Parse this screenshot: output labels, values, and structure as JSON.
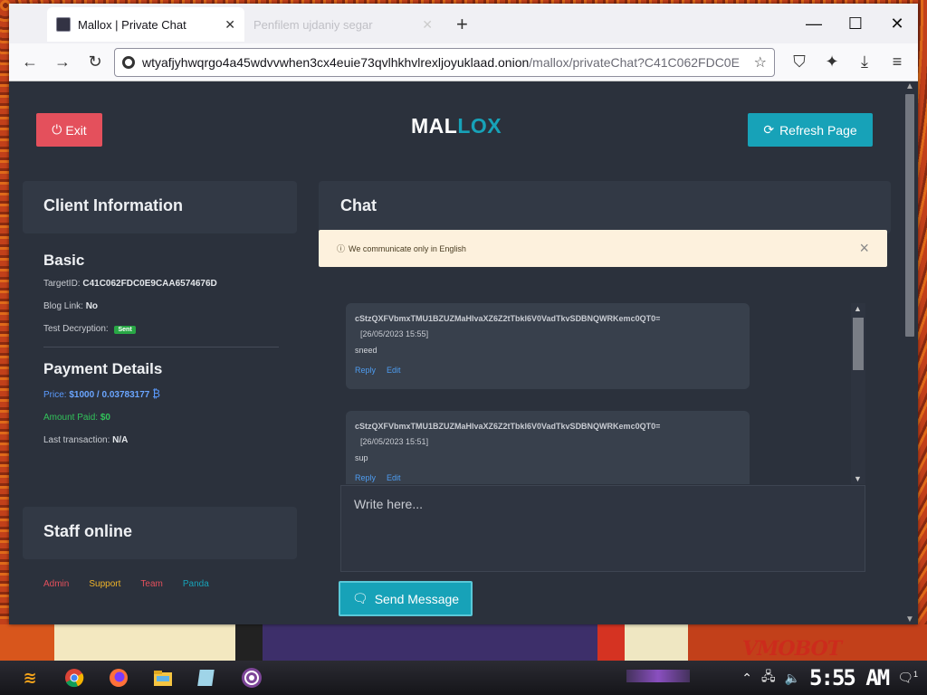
{
  "browser": {
    "tabs": [
      {
        "title": "Mallox | Private Chat",
        "active": true
      },
      {
        "title": "Penfilem ujdaniy segar",
        "active": false
      }
    ],
    "url_host": "wtyafjyhwqrgo4a45wdvvwhen3cx4euie73qvlhkhvlrexljoyuklaad.onion",
    "url_path": "/mallox/privateChat?C41C062FDC0E"
  },
  "header": {
    "exit_label": "Exit",
    "logo_part1": "MAL",
    "logo_part2": "LOX",
    "refresh_label": "Refresh Page"
  },
  "client_info": {
    "title": "Client Information",
    "basic_title": "Basic",
    "target_label": "TargetID:",
    "target_value": "C41C062FDC0E9CAA6574676D",
    "blog_label": "Blog Link:",
    "blog_value": "No",
    "test_label": "Test Decryption:",
    "test_badge": "Sent",
    "payment_title": "Payment Details",
    "price_label": "Price:",
    "price_value": "$1000 / 0.03783177",
    "paid_label": "Amount Paid:",
    "paid_value": "$0",
    "last_label": "Last transaction:",
    "last_value": "N/A"
  },
  "staff": {
    "title": "Staff online",
    "members": [
      {
        "name": "Admin",
        "color": "#e4505c"
      },
      {
        "name": "Support",
        "color": "#f0b429"
      },
      {
        "name": "Team",
        "color": "#e4505c"
      },
      {
        "name": "Panda",
        "color": "#17a2b8"
      }
    ]
  },
  "chat": {
    "title": "Chat",
    "alert": "We communicate only in English",
    "messages": [
      {
        "id": "cStzQXFVbmxTMU1BZUZMaHlvaXZ6Z2tTbkl6V0VadTkvSDBNQWRKemc0QT0=",
        "time": "[26/05/2023 15:55]",
        "text": "sneed",
        "reply": "Reply",
        "edit": "Edit"
      },
      {
        "id": "cStzQXFVbmxTMU1BZUZMaHlvaXZ6Z2tTbkl6V0VadTkvSDBNQWRKemc0QT0=",
        "time": "[26/05/2023 15:51]",
        "text": "sup",
        "reply": "Reply",
        "edit": "Edit"
      }
    ],
    "input_placeholder": "Write here...",
    "send_label": "Send Message"
  },
  "taskbar": {
    "clock": "5:55 AM",
    "notifications": "1"
  },
  "desktop": {
    "wallpaper_text": "VMOBOT"
  },
  "icons": [
    "power-icon",
    "refresh-icon",
    "bitcoin-icon",
    "info-icon",
    "message-icon",
    "chrome-icon",
    "firefox-icon",
    "folder-icon",
    "tor-icon"
  ]
}
